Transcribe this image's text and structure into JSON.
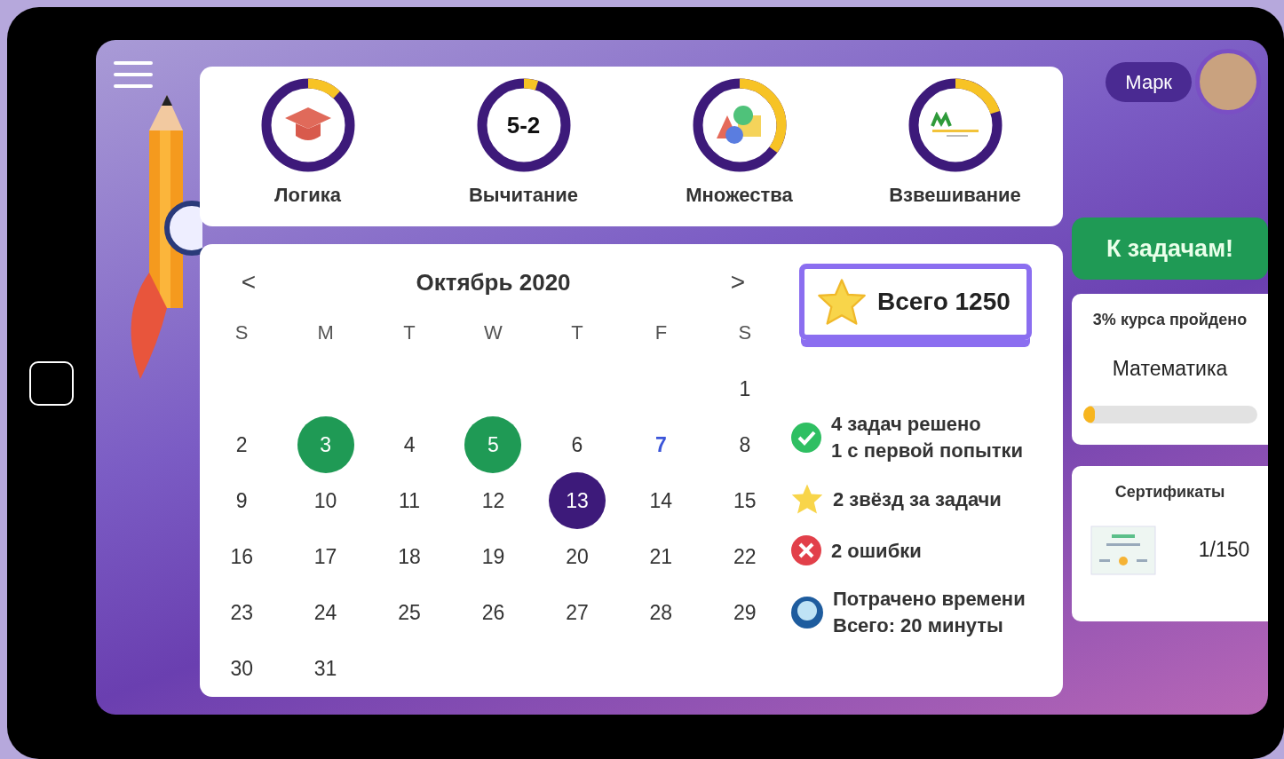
{
  "user": {
    "name": "Марк"
  },
  "skills": [
    {
      "label": "Логика",
      "level": 0.12,
      "kind": "cap"
    },
    {
      "label": "Вычитание",
      "level": 0.05,
      "kind": "text",
      "badge": "5-2"
    },
    {
      "label": "Множества",
      "level": 0.35,
      "kind": "shapes"
    },
    {
      "label": "Взвешивание",
      "level": 0.2,
      "kind": "scale"
    }
  ],
  "calendar": {
    "prev": "<",
    "title": "Октябрь 2020",
    "next": ">",
    "weekdays": [
      "S",
      "M",
      "T",
      "W",
      "T",
      "F",
      "S"
    ],
    "weeks": [
      [
        {
          "day": "1",
          "kind": "plain"
        }
      ],
      [
        {
          "day": "2",
          "kind": "plain"
        },
        {
          "day": "3",
          "kind": "done"
        },
        {
          "day": "4",
          "kind": "plain"
        },
        {
          "day": "5",
          "kind": "done"
        },
        {
          "day": "6",
          "kind": "plain"
        },
        {
          "day": "7",
          "kind": "marked"
        },
        {
          "day": "8",
          "kind": "plain"
        }
      ],
      [
        {
          "day": "9",
          "kind": "plain"
        },
        {
          "day": "10",
          "kind": "plain"
        },
        {
          "day": "11",
          "kind": "plain"
        },
        {
          "day": "12",
          "kind": "plain"
        },
        {
          "day": "13",
          "kind": "today"
        },
        {
          "day": "14",
          "kind": "plain"
        },
        {
          "day": "15",
          "kind": "plain"
        }
      ],
      [
        {
          "day": "16",
          "kind": "plain"
        },
        {
          "day": "17",
          "kind": "plain"
        },
        {
          "day": "18",
          "kind": "plain"
        },
        {
          "day": "19",
          "kind": "plain"
        },
        {
          "day": "20",
          "kind": "plain"
        },
        {
          "day": "21",
          "kind": "plain"
        },
        {
          "day": "22",
          "kind": "plain"
        }
      ],
      [
        {
          "day": "23",
          "kind": "plain"
        },
        {
          "day": "24",
          "kind": "plain"
        },
        {
          "day": "25",
          "kind": "plain"
        },
        {
          "day": "26",
          "kind": "plain"
        },
        {
          "day": "27",
          "kind": "plain"
        },
        {
          "day": "28",
          "kind": "plain"
        },
        {
          "day": "29",
          "kind": "plain"
        }
      ],
      [
        {
          "day": "30",
          "kind": "plain"
        },
        {
          "day": "31",
          "kind": "plain"
        }
      ]
    ]
  },
  "score": {
    "text": "Всего 1250"
  },
  "stats": [
    {
      "kind": "check",
      "lines": [
        "4 задач решено",
        "1 с первой попытки"
      ]
    },
    {
      "kind": "star",
      "lines": [
        "2 звёзд за задачи"
      ]
    },
    {
      "kind": "cross",
      "lines": [
        "2 ошибки"
      ]
    },
    {
      "kind": "timer",
      "lines": [
        "Потрачено времени",
        "Всего: 20 минуты"
      ]
    }
  ],
  "cta": {
    "label": "К задачам!"
  },
  "course": {
    "caption": "3% курса пройдено",
    "subject": "Математика",
    "level": 0.07
  },
  "certificates": {
    "title": "Сертификаты",
    "count": "1/150"
  }
}
